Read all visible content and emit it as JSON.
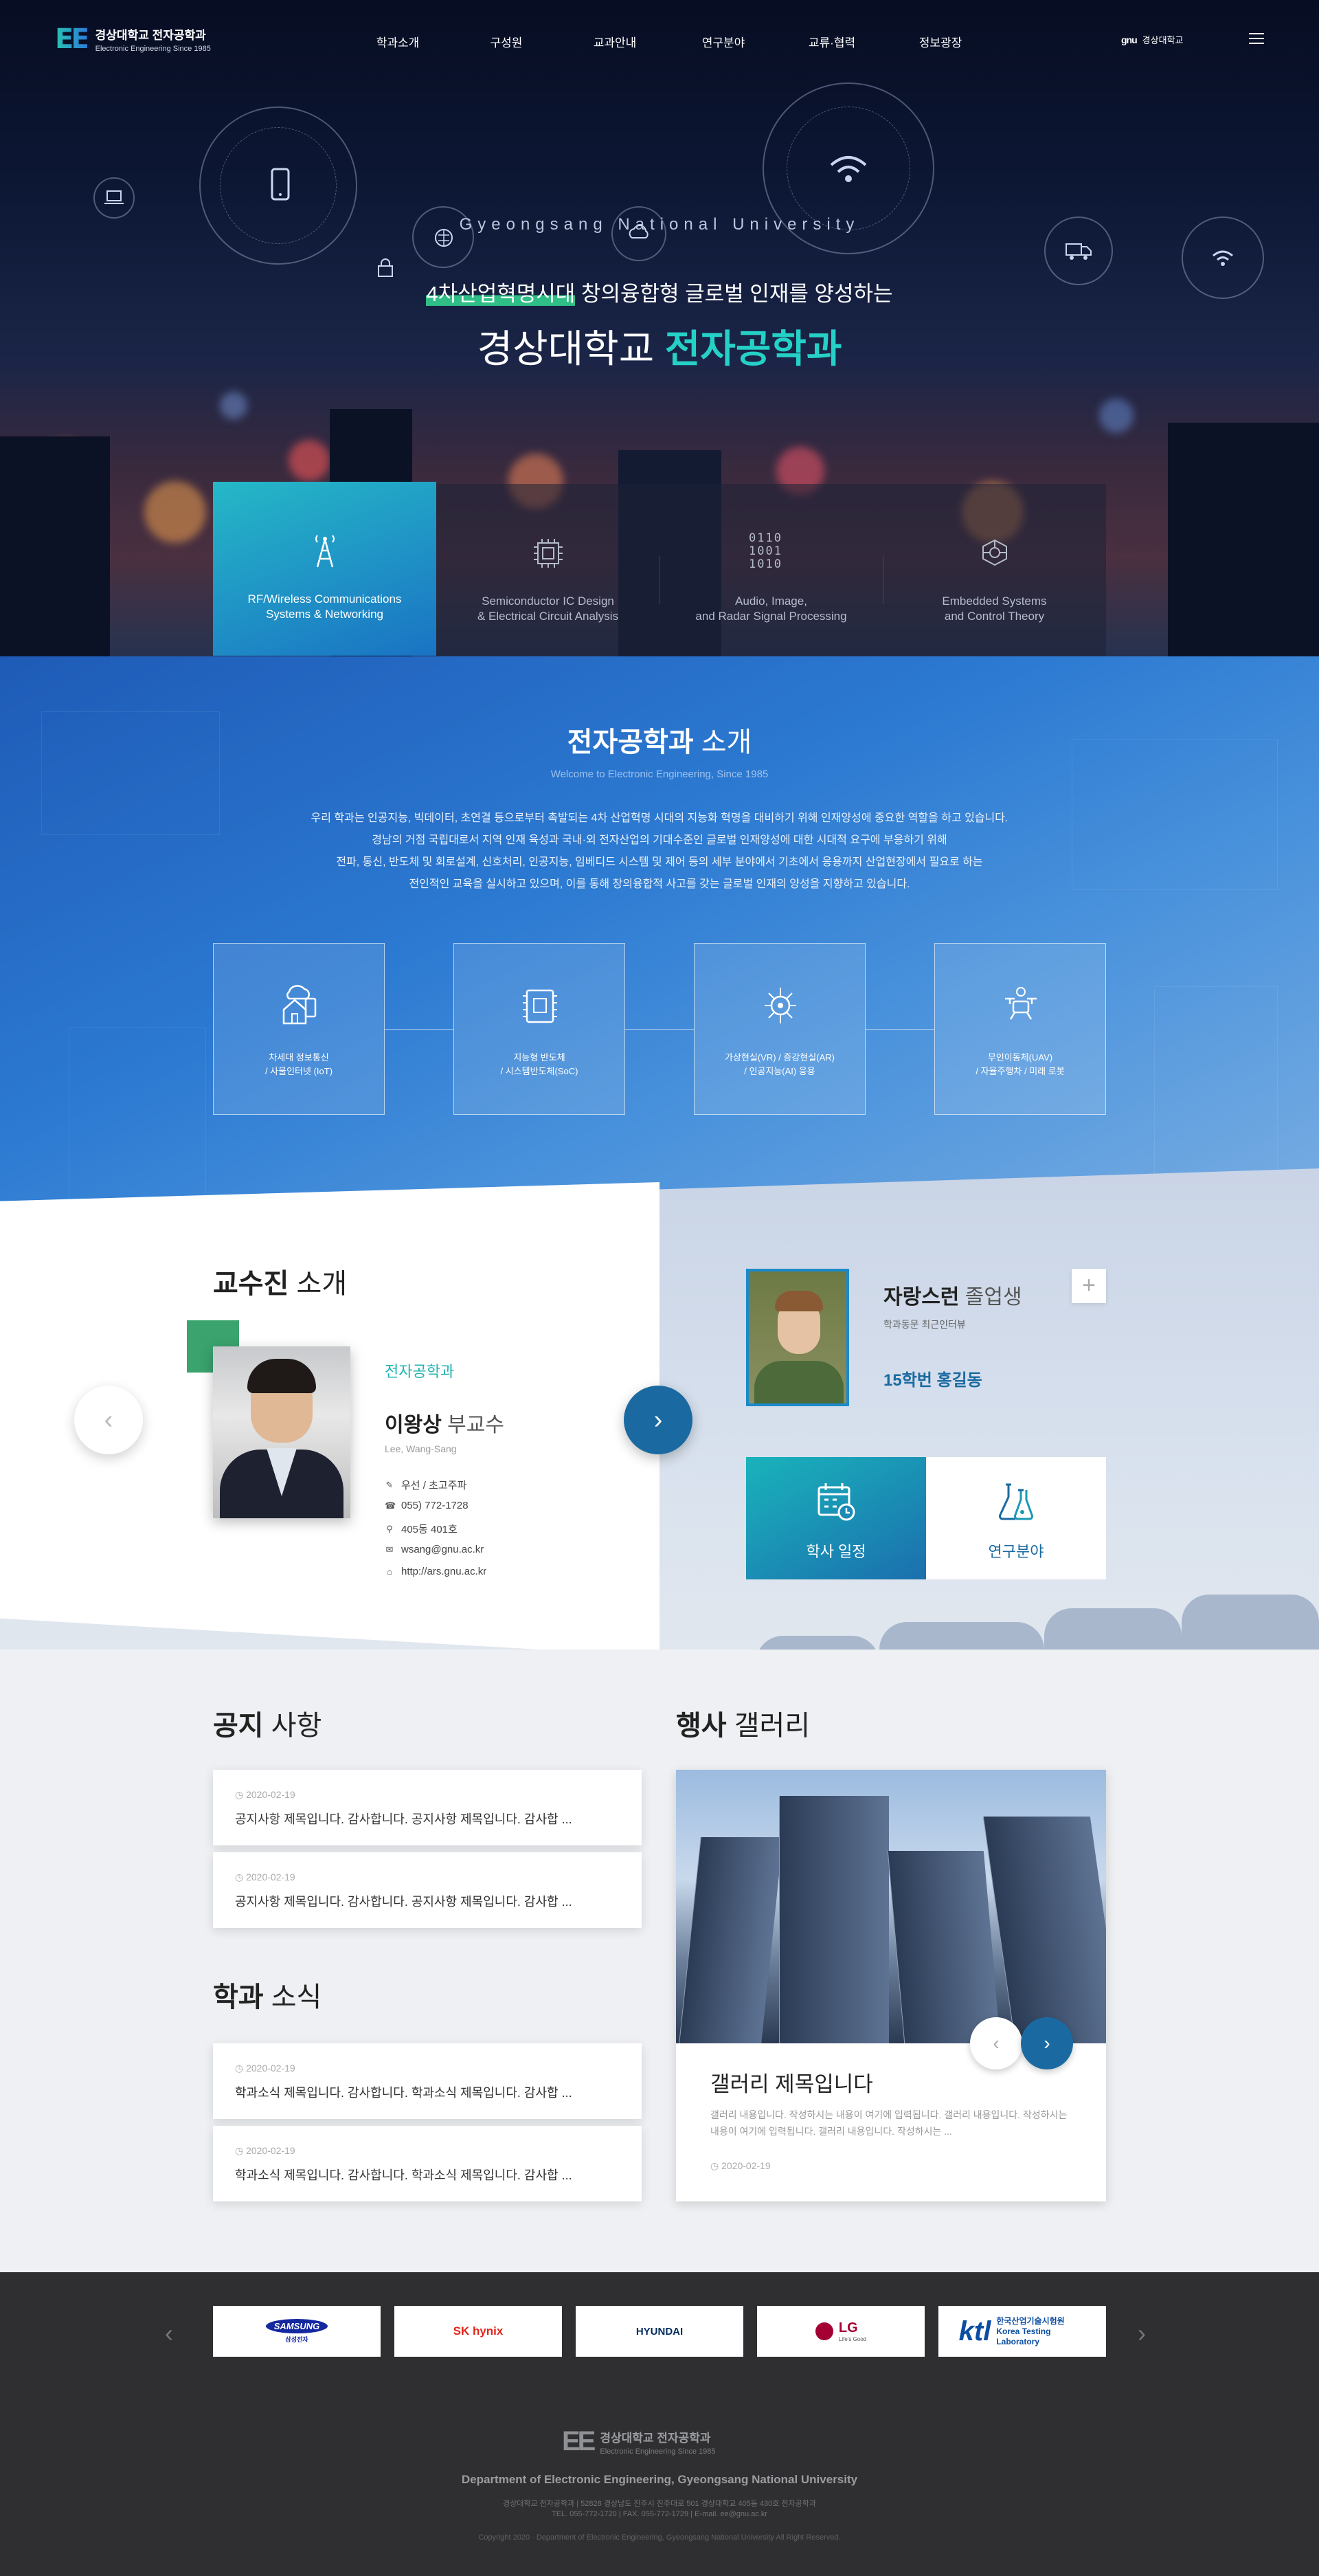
{
  "header": {
    "logo_mark": "EE",
    "logo_title": "경상대학교 전자공학과",
    "logo_sub": "Electronic Engineering Since 1985",
    "nav": [
      "학과소개",
      "구성원",
      "교과안내",
      "연구분야",
      "교류·협력",
      "정보광장"
    ],
    "univ_mark": "gnu",
    "univ_label": "경상대학교"
  },
  "hero": {
    "subtitle": "Gyeongsang National University",
    "line1_highlight": "4차산업혁명시대",
    "line1_rest": " 창의융합형 글로벌 인재를 양성하는",
    "line2_a": "경상대학교 ",
    "line2_b": "전자공학과",
    "fields": [
      {
        "line1": "RF/Wireless Communications",
        "line2": "Systems & Networking",
        "icon": "antenna-tower-icon"
      },
      {
        "line1": "Semiconductor IC Design",
        "line2": "& Electrical Circuit Analysis",
        "icon": "chip-icon"
      },
      {
        "line1": "Audio, Image,",
        "line2": "and Radar Signal Processing",
        "icon": "binary-icon"
      },
      {
        "line1": "Embedded Systems",
        "line2": "and Control Theory",
        "icon": "circuit-cube-icon"
      }
    ],
    "binary_lines": [
      "0110",
      "1001",
      "1010"
    ]
  },
  "intro": {
    "title_bold": "전자공학과",
    "title_rest": " 소개",
    "en": "Welcome to Electronic Engineering, Since 1985",
    "desc": [
      "우리 학과는 인공지능, 빅데이터, 초연결 등으로부터 촉발되는 4차 산업혁명 시대의 지능화 혁명을 대비하기 위해 인재양성에 중요한 역할을 하고 있습니다.",
      "경남의 거점 국립대로서 지역 인재 육성과 국내·외 전자산업의 기대수준인 글로벌 인재양성에 대한 시대적 요구에 부응하기 위해",
      "전파, 통신, 반도체 및 회로설계, 신호처리, 인공지능, 임베디드 시스템 및 제어 등의 세부 분야에서 기초에서 응용까지 산업현장에서 필요로 하는",
      "전인적인 교육을 실시하고 있으며, 이를 통해 창의융합적 사고를 갖는 글로벌 인재의 양성을 지향하고 있습니다."
    ],
    "boxes": [
      {
        "line1": "차세대 정보통신",
        "line2": "/ 사물인터넷 (IoT)",
        "icon": "iot-house-icon"
      },
      {
        "line1": "지능형 반도체",
        "line2": "/ 시스템반도체(SoC)",
        "icon": "semiconductor-icon"
      },
      {
        "line1": "가상현실(VR) / 증강현실(AR)",
        "line2": "/ 인공지능(AI) 응용",
        "icon": "ai-brain-icon"
      },
      {
        "line1": "무인이동체(UAV)",
        "line2": "/ 자율주행차 / 미래 로봇",
        "icon": "drone-icon"
      }
    ]
  },
  "faculty": {
    "title_bold": "교수진",
    "title_rest": " 소개",
    "dept": "전자공학과",
    "name": "이왕상",
    "position": " 부교수",
    "name_en": "Lee, Wang-Sang",
    "info": [
      {
        "icon": "pencil-icon",
        "text": "우선 / 초고주파"
      },
      {
        "icon": "phone-icon",
        "text": "055) 772-1728"
      },
      {
        "icon": "location-icon",
        "text": "405동 401호"
      },
      {
        "icon": "mail-icon",
        "text": "wsang@gnu.ac.kr"
      },
      {
        "icon": "home-icon",
        "text": "http://ars.gnu.ac.kr"
      }
    ]
  },
  "alumni": {
    "title_bold": "자랑스런",
    "title_rest": " 졸업생",
    "sub": "학과동문 최근인터뷰",
    "name": "15학번 홍길동",
    "plus": "+"
  },
  "quick": {
    "schedule": "학사 일정",
    "research": "연구분야",
    "schedule_color": "#1aa0b8",
    "research_color": "#1a6aa1"
  },
  "notice": {
    "title_bold": "공지",
    "title_rest": " 사항",
    "items": [
      {
        "date": "2020-02-19",
        "title": "공지사항 제목입니다. 감사합니다. 공지사항 제목입니다. 감사합 ..."
      },
      {
        "date": "2020-02-19",
        "title": "공지사항 제목입니다. 감사합니다. 공지사항 제목입니다. 감사합 ..."
      }
    ]
  },
  "news": {
    "title_bold": "학과",
    "title_rest": " 소식",
    "items": [
      {
        "date": "2020-02-19",
        "title": "학과소식 제목입니다. 감사합니다. 학과소식 제목입니다. 감사합 ..."
      },
      {
        "date": "2020-02-19",
        "title": "학과소식 제목입니다. 감사합니다. 학과소식 제목입니다. 감사합 ..."
      }
    ]
  },
  "gallery": {
    "title_bold": "행사",
    "title_rest": " 갤러리",
    "item_title": "갤러리 제목입니다",
    "item_text": "갤러리 내용입니다. 작성하시는 내용이 여기에 입력됩니다. 갤러리 내용입니다. 작성하시는 내용이 여기에 입력됩니다. 갤러리 내용입니다. 작성하시는 ...",
    "item_date": "2020-02-19"
  },
  "partners": [
    {
      "name": "SAMSUNG",
      "sub": "삼성전자",
      "color": "#1428a0"
    },
    {
      "name": "SK hynix",
      "sub": "",
      "color": "#e2231a"
    },
    {
      "name": "HYUNDAI",
      "sub": "",
      "color": "#002c5f"
    },
    {
      "name": "LG",
      "sub": "Life's Good",
      "color": "#a50034"
    },
    {
      "name": "ktl",
      "sub": "한국산업기술시험원 Korea Testing Laboratory",
      "color": "#0b4da2"
    }
  ],
  "footer": {
    "logo_mark": "EE",
    "logo_title": "경상대학교 전자공학과",
    "logo_sub": "Electronic Engineering Since 1985",
    "dept": "Department of Electronic Engineering, Gyeongsang National University",
    "addr1": "경상대학교 전자공학과  |  52828 경상남도 진주시 진주대로 501 경상대학교 405동 430호 전자공학과",
    "addr2": "TEL. 055-772-1720   |   FAX. 055-772-1729   |   E-mail. ee@gnu.ac.kr",
    "copy": "Copyright 2020 · Department of Electronic Engineering, Gyeongsang National University All Right Reserved."
  }
}
